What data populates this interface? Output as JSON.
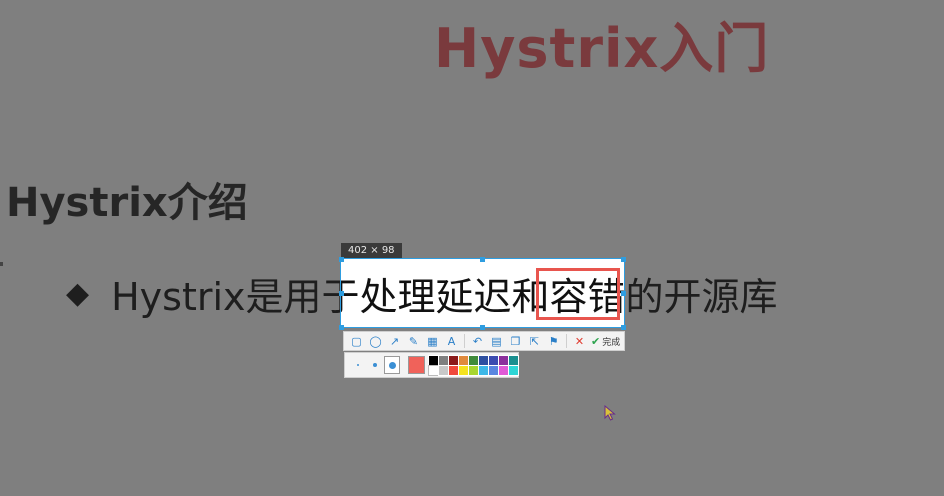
{
  "slide": {
    "title": "Hystrix入门",
    "section_heading": "Hystrix介绍",
    "bullet_symbol": "◆",
    "bullet_text": "Hystrix是用于处理延迟和容错的开源库",
    "title_color": "#7a3a3d"
  },
  "capture": {
    "size_label": "402 × 98",
    "frame_color": "#2e9de0",
    "annotation_color": "#e8554e"
  },
  "toolbar": {
    "tools": [
      {
        "name": "rectangle-tool-icon",
        "glyph": "▢"
      },
      {
        "name": "ellipse-tool-icon",
        "glyph": "◯"
      },
      {
        "name": "arrow-tool-icon",
        "glyph": "↗"
      },
      {
        "name": "pen-tool-icon",
        "glyph": "✎"
      },
      {
        "name": "mosaic-tool-icon",
        "glyph": "▦"
      },
      {
        "name": "text-tool-icon",
        "glyph": "A"
      },
      {
        "name": "undo-icon",
        "glyph": "↶"
      },
      {
        "name": "save-icon",
        "glyph": "▤"
      },
      {
        "name": "copy-icon",
        "glyph": "❐"
      },
      {
        "name": "share-icon",
        "glyph": "⇱"
      },
      {
        "name": "pin-icon",
        "glyph": "⚑"
      }
    ],
    "cancel_glyph": "✕",
    "done_glyph": "✔",
    "done_label": "完成"
  },
  "style_panel": {
    "current_color": "#f0625a",
    "palette": [
      "#000000",
      "#7f7f7f",
      "#8b1a1a",
      "#e08a3c",
      "#3f8a3a",
      "#2d4fa0",
      "#3b4bb0",
      "#8b2f9c",
      "#1a8f8f",
      "#ffffff",
      "#c8c8c8",
      "#f04a3c",
      "#f5e21e",
      "#a8d630",
      "#3db8e8",
      "#5a86e0",
      "#e05ad6",
      "#2ed6d6"
    ]
  }
}
